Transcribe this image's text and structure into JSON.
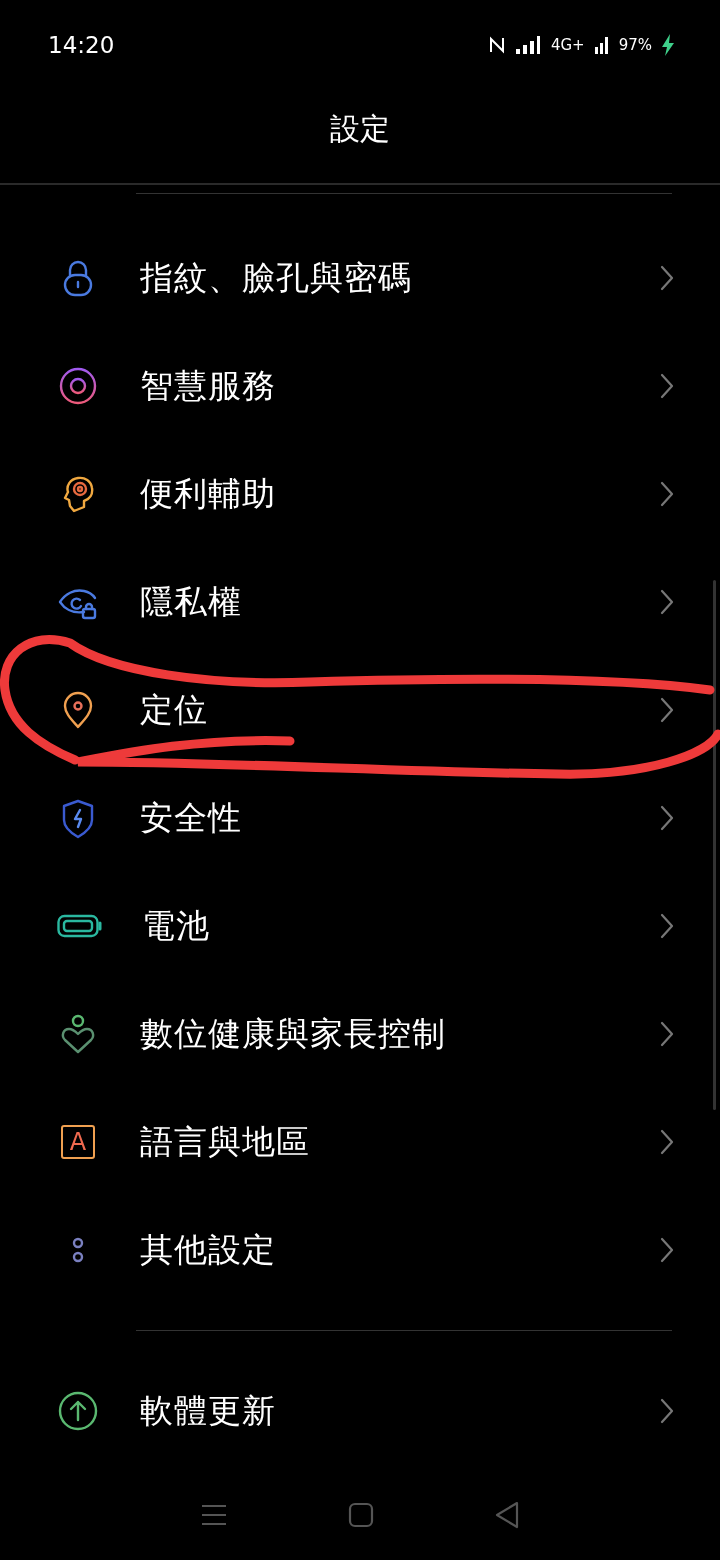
{
  "status_bar": {
    "time": "14:20",
    "network": "4G+",
    "battery": "97%",
    "charging": true
  },
  "title": "設定",
  "sections": [
    {
      "items": [
        {
          "kind": "lock",
          "label": "指紋、臉孔與密碼"
        },
        {
          "kind": "ring",
          "label": "智慧服務"
        },
        {
          "kind": "head",
          "label": "便利輔助"
        },
        {
          "kind": "eyelock",
          "label": "隱私權"
        },
        {
          "kind": "pin",
          "label": "定位"
        },
        {
          "kind": "shield",
          "label": "安全性"
        },
        {
          "kind": "battery",
          "label": "電池"
        },
        {
          "kind": "wellbeing",
          "label": "數位健康與家長控制"
        },
        {
          "kind": "letter",
          "label": "語言與地區",
          "glyph": "A"
        },
        {
          "kind": "dots",
          "label": "其他設定"
        }
      ]
    },
    {
      "items": [
        {
          "kind": "update",
          "label": "軟體更新"
        }
      ]
    }
  ]
}
